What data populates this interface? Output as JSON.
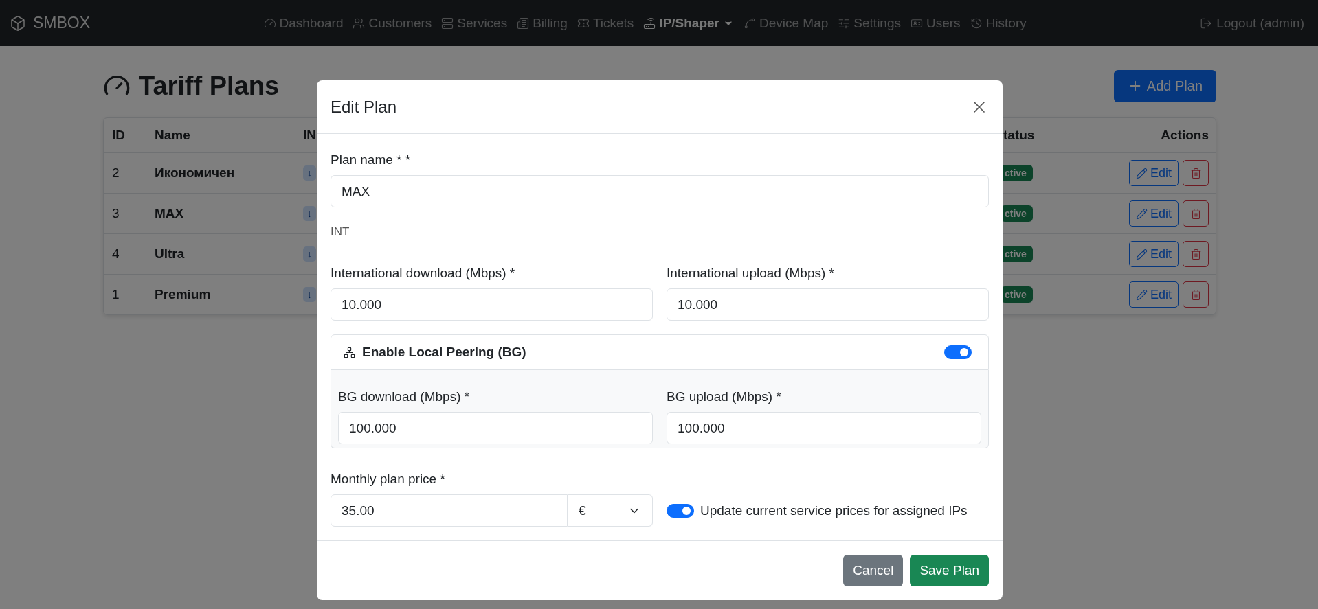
{
  "navbar": {
    "brand": "SMBOX",
    "items": [
      {
        "label": "Dashboard",
        "selected": false
      },
      {
        "label": "Customers",
        "selected": false
      },
      {
        "label": "Services",
        "selected": false
      },
      {
        "label": "Billing",
        "selected": false
      },
      {
        "label": "Tickets",
        "selected": false
      },
      {
        "label": "IP/Shaper",
        "selected": true
      },
      {
        "label": "Device Map",
        "selected": false
      },
      {
        "label": "Settings",
        "selected": false
      },
      {
        "label": "Users",
        "selected": false
      },
      {
        "label": "History",
        "selected": false
      }
    ],
    "logout": "Logout (admin)"
  },
  "page": {
    "title": "Tariff Plans",
    "add_button": "Add Plan"
  },
  "table": {
    "columns": [
      "ID",
      "Name",
      "IN",
      "tatus",
      "Actions"
    ],
    "rows": [
      {
        "id": "2",
        "name": "Икономичен",
        "column_3": "↓",
        "status": "ctive",
        "edit": "Edit"
      },
      {
        "id": "3",
        "name": "MAX",
        "column_3": "↓",
        "status": "ctive",
        "edit": "Edit"
      },
      {
        "id": "4",
        "name": "Ultra",
        "column_3": "↓",
        "status": "ctive",
        "edit": "Edit"
      },
      {
        "id": "1",
        "name": "Premium",
        "column_3": "↓",
        "status": "ctive",
        "edit": "Edit"
      }
    ]
  },
  "modal": {
    "title": "Edit Plan",
    "plan_name": {
      "label": "Plan name * *",
      "value": "MAX"
    },
    "section": "INT",
    "international": [
      {
        "label": "International download (Mbps) *",
        "value": "10.000"
      },
      {
        "label": "International upload (Mbps) *",
        "value": "10.000"
      }
    ],
    "peering": {
      "label": "Enable Local Peering (BG)",
      "on": true,
      "fields": [
        {
          "label": "BG download (Mbps) *",
          "value": "100.000"
        },
        {
          "label": "BG upload (Mbps) *",
          "value": "100.000"
        }
      ]
    },
    "price": {
      "label": "Monthly plan price *",
      "value": "35.00",
      "currency": "€"
    },
    "update_prices": {
      "label": "Update current service prices for assigned IPs",
      "on": true
    },
    "buttons": {
      "cancel": "Cancel",
      "save": "Save Plan"
    }
  }
}
